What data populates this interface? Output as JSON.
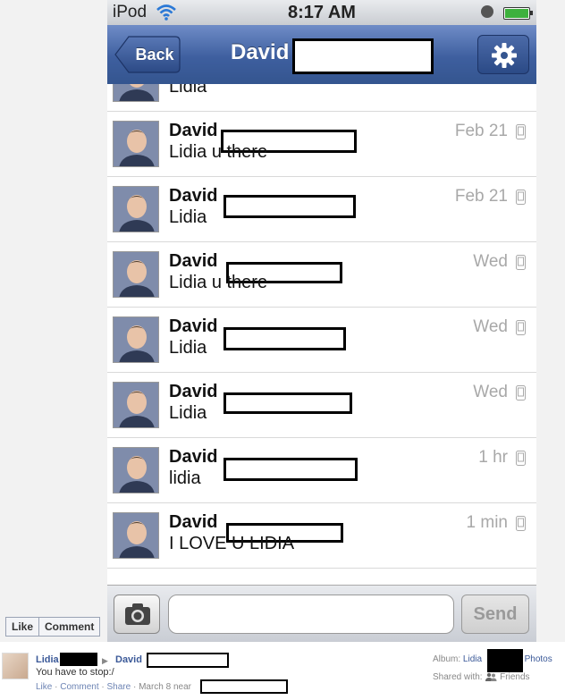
{
  "status_bar": {
    "carrier": "iPod",
    "time": "8:17 AM"
  },
  "nav": {
    "back_label": "Back",
    "title": "David"
  },
  "messages": [
    {
      "sender": "",
      "text": "Lidia",
      "time": ""
    },
    {
      "sender": "David",
      "text": "Lidia u there",
      "time": "Feb 21"
    },
    {
      "sender": "David",
      "text": "Lidia",
      "time": "Feb 21"
    },
    {
      "sender": "David",
      "text": "Lidia u there",
      "time": "Wed"
    },
    {
      "sender": "David",
      "text": "Lidia",
      "time": "Wed"
    },
    {
      "sender": "David",
      "text": "Lidia",
      "time": "Wed"
    },
    {
      "sender": "David",
      "text": "lidia",
      "time": "1 hr"
    },
    {
      "sender": "David",
      "text": "I LOVE U LIDIA",
      "time": "1 min"
    }
  ],
  "composer": {
    "send_label": "Send",
    "input_value": ""
  },
  "facebook": {
    "like_label": "Like",
    "comment_label": "Comment",
    "post": {
      "from": "Lidia",
      "to": "David",
      "text": "You have to stop:/",
      "action_like": "Like",
      "action_comment": "Comment",
      "action_share": "Share",
      "date": "March 8 near",
      "album_prefix": "Album:",
      "album_name": "Lidia",
      "album_suffix": "Photos",
      "shared_prefix": "Shared with:",
      "shared_with": "Friends"
    }
  },
  "colors": {
    "nav_blue": "#3e5f9f",
    "link_blue": "#3b5998",
    "timestamp_gray": "#a8a8a8"
  },
  "icons": {
    "wifi": "wifi-icon",
    "settings": "gear-icon",
    "camera": "camera-icon",
    "device": "phone-icon",
    "lock": "lock-icon",
    "battery": "battery-icon"
  }
}
